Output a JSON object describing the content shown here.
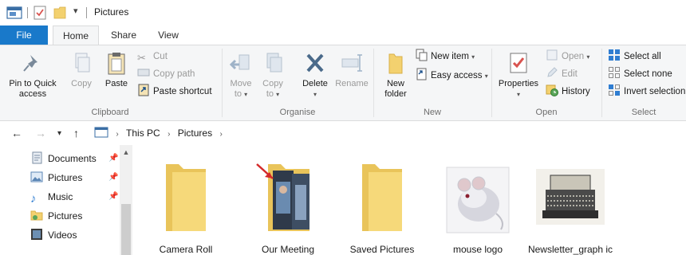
{
  "window": {
    "title": "Pictures"
  },
  "tabs": {
    "file": "File",
    "home": "Home",
    "share": "Share",
    "view": "View"
  },
  "ribbon": {
    "clipboard": {
      "label": "Clipboard",
      "pin_line1": "Pin to Quick",
      "pin_line2": "access",
      "copy": "Copy",
      "paste": "Paste",
      "cut": "Cut",
      "copy_path": "Copy path",
      "paste_shortcut": "Paste shortcut"
    },
    "organise": {
      "label": "Organise",
      "move_line1": "Move",
      "move_line2": "to",
      "copy_line1": "Copy",
      "copy_line2": "to",
      "delete": "Delete",
      "rename": "Rename"
    },
    "new": {
      "label": "New",
      "new_folder_line1": "New",
      "new_folder_line2": "folder",
      "new_item": "New item",
      "easy_access": "Easy access"
    },
    "open": {
      "label": "Open",
      "properties": "Properties",
      "open": "Open",
      "edit": "Edit",
      "history": "History"
    },
    "select": {
      "label": "Select",
      "select_all": "Select all",
      "select_none": "Select none",
      "invert_selection": "Invert selection"
    }
  },
  "address": {
    "crumbs": [
      "This PC",
      "Pictures"
    ]
  },
  "nav": {
    "items": [
      {
        "label": "Documents",
        "pinned": true
      },
      {
        "label": "Pictures",
        "pinned": true
      },
      {
        "label": "Music",
        "pinned": true
      },
      {
        "label": "Pictures",
        "pinned": false
      },
      {
        "label": "Videos",
        "pinned": false
      }
    ]
  },
  "files": [
    {
      "label": "Camera Roll",
      "type": "folder"
    },
    {
      "label": "Our Meeting",
      "type": "photo-folder"
    },
    {
      "label": "Saved Pictures",
      "type": "folder"
    },
    {
      "label": "mouse logo",
      "type": "image"
    },
    {
      "label": "Newsletter_graph ic",
      "type": "image"
    }
  ],
  "colors": {
    "accent": "#1979ca",
    "folder": "#f3d16f",
    "ribbon_bg": "#f5f6f7"
  }
}
